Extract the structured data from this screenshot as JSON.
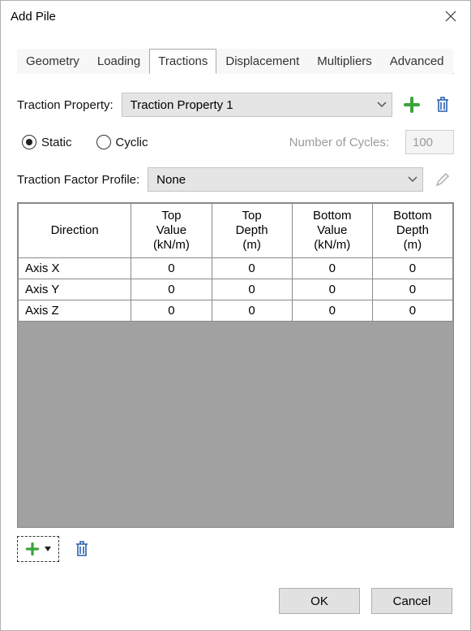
{
  "window": {
    "title": "Add Pile"
  },
  "tabs": [
    "Geometry",
    "Loading",
    "Tractions",
    "Displacement",
    "Multipliers",
    "Advanced"
  ],
  "selected_tab_index": 2,
  "traction": {
    "property_label": "Traction Property:",
    "property_value": "Traction Property 1",
    "mode_static": "Static",
    "mode_cyclic": "Cyclic",
    "cycles_label": "Number of Cycles:",
    "cycles_value": "100",
    "profile_label": "Traction Factor Profile:",
    "profile_value": "None"
  },
  "table": {
    "headers": {
      "direction": "Direction",
      "top_value": "Top Value (kN/m)",
      "top_depth": "Top Depth (m)",
      "bottom_value": "Bottom Value (kN/m)",
      "bottom_depth": "Bottom Depth (m)"
    },
    "rows": [
      {
        "direction": "Axis X",
        "top_value": "0",
        "top_depth": "0",
        "bottom_value": "0",
        "bottom_depth": "0"
      },
      {
        "direction": "Axis Y",
        "top_value": "0",
        "top_depth": "0",
        "bottom_value": "0",
        "bottom_depth": "0"
      },
      {
        "direction": "Axis Z",
        "top_value": "0",
        "top_depth": "0",
        "bottom_value": "0",
        "bottom_depth": "0"
      }
    ]
  },
  "buttons": {
    "ok": "OK",
    "cancel": "Cancel"
  }
}
